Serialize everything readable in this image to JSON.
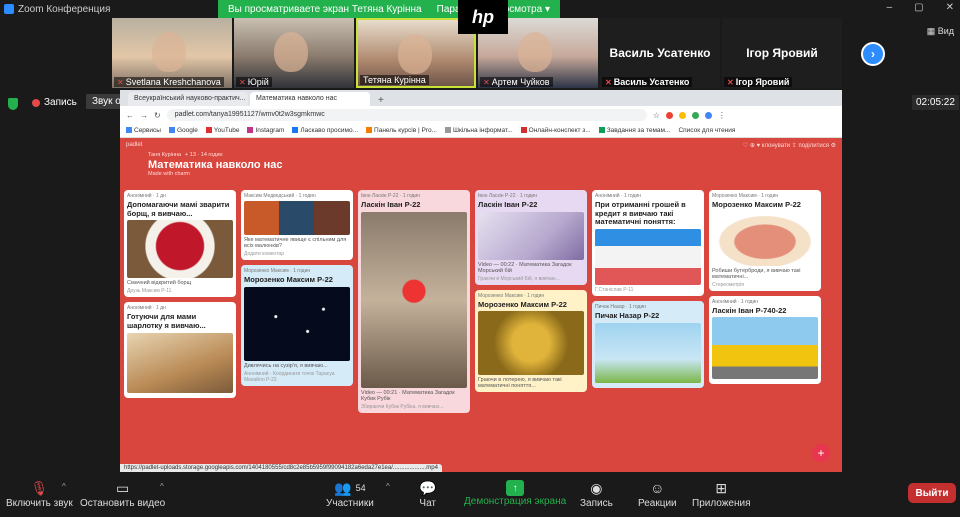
{
  "window": {
    "title": "Zoom Конференция",
    "controls": [
      "–",
      "▢",
      "✕"
    ]
  },
  "share_banner": {
    "text": "Вы просматриваете экран Тетяна Курінна",
    "options": "Параметры просмотра"
  },
  "participants": [
    {
      "name": "Svetlana Kreshchanova"
    },
    {
      "name": "Юрій"
    },
    {
      "name": "Тетяна Курінна"
    },
    {
      "name": "Артем Чуйков"
    },
    {
      "name": "Василь Усатенко",
      "big": "Василь Усатенко"
    },
    {
      "name": "Ігор Яровий",
      "big": "Ігор Яровий"
    }
  ],
  "view_label": "Вид",
  "status": {
    "record": "Запись",
    "tooltip": "Звук оригинала: выкл.",
    "timer": "02:05:22"
  },
  "browser": {
    "tabs": [
      "Всеукраїнський науково-практич...",
      "Математика навколо нас"
    ],
    "url": "padlet.com/tanya19951127/wmv0t2w3sgmkmwc",
    "bookmarks": [
      "Сервисы",
      "Google",
      "YouTube",
      "Instagram",
      "Ласкаво просимо...",
      "Панель курсів | Pro...",
      "Шкільна інформат...",
      "Онлайн-конспект з...",
      "Завдання за темам...",
      "Список для чтения"
    ],
    "status_url": "https://padlet-uploads.storage.googleapis.com/1404180555/cd8c2e85b5959f99094182a6eda27e1ea/....................mp4"
  },
  "padlet": {
    "brand": "padlet",
    "author": "Таня Курінна",
    "author_meta": "+ 13 · 14 годин",
    "title": "Математика навколо нас",
    "subtitle": "Made with charm",
    "actions": "♡  ⊕ ♥ клонувати  ⇪ поділитися  ⚙",
    "columns": [
      [
        {
          "style": "white",
          "meta": "Анонімний · 1 дн",
          "title": "Допомагаючи мамі зварити борщ, я вивчаю...",
          "img": "borsch",
          "txt": "Смачний відкритий борщ",
          "footer": "Друзь Максим Р-11"
        },
        {
          "style": "white",
          "meta": "Анонімний · 1 дн",
          "title": "Готуючи для мами шарлотку я вивчаю...",
          "img": "cake",
          "txt": "",
          "footer": ""
        }
      ],
      [
        {
          "style": "white",
          "meta": "Максим Медведський · 1 годин",
          "title": "",
          "img": "eyes",
          "txt": "Яке математичне явище є спільним для всіх малюнків?",
          "footer": "Додати коментар"
        },
        {
          "style": "blue",
          "meta": "Морозенко Максим · 1 годин",
          "title": "Морозенко Максим Р-22",
          "img": "stars",
          "txt": "Дивлячись на сузір'я, я вивчаю...",
          "footer": "Анонімний · Координати точок Тарасуа Михайло Р-22"
        }
      ],
      [
        {
          "style": "pink",
          "meta": "Івон Ласкін Р-22 · 1 годин",
          "title": "Ласкін Іван Р-22",
          "img": "cube",
          "txt": "Video — 00:21 · Математика Загадок Кубик Рубік",
          "footer": "Збираючи Кубик Рубіка, я вивчаю..."
        }
      ],
      [
        {
          "style": "lilac",
          "meta": "Івон Ласкін Р-22 · 1 годин",
          "title": "Ласкін Іван Р-22",
          "img": "hand",
          "txt": "Video — 00:22 · Математика Загадок Морський бій",
          "footer": "Граючи в Морський Бій, я вивчаю..."
        },
        {
          "style": "yellow",
          "meta": "Морозенко Максим · 1 годин",
          "title": "Морозенко Максим Р-22",
          "img": "coins",
          "txt": "Граючи в лотерею, я вивчаю такі математичні поняття...",
          "footer": ""
        }
      ],
      [
        {
          "style": "white",
          "meta": "Анонімний · 1 годин",
          "title": "При отриманні грошей в кредит я вивчаю такі математичні поняття:",
          "img": "shop",
          "txt": "",
          "footer": "Г.Станіслав Р-11"
        },
        {
          "style": "blue",
          "meta": "Пичак Назар · 1 годин",
          "title": "Пичак Назар Р-22",
          "img": "fish",
          "txt": "",
          "footer": ""
        }
      ],
      [
        {
          "style": "white",
          "meta": "Морозенко Максим · 1 годин",
          "title": "Морозенко Максим Р-22",
          "img": "sandwich",
          "txt": "Робиши бутерброди, я вивчаю такі математичні...",
          "footer": "Стереометрія"
        },
        {
          "style": "white",
          "meta": "Анонімний · 1 годин",
          "title": "Ласкін Іван Р-740-22",
          "img": "bus",
          "txt": "",
          "footer": ""
        }
      ]
    ]
  },
  "toolbar": {
    "mute": "Включить звук",
    "video": "Остановить видео",
    "participants": "Участники",
    "participants_count": "54",
    "chat": "Чат",
    "share": "Демонстрация экрана",
    "record": "Запись",
    "reactions": "Реакции",
    "apps": "Приложения",
    "leave": "Выйти"
  }
}
